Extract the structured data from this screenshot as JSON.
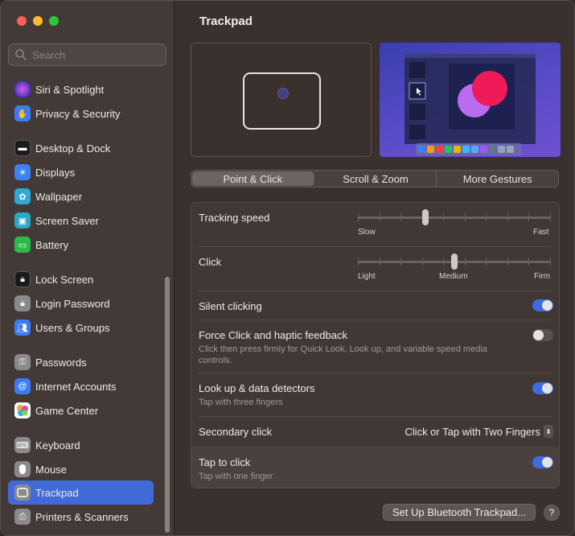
{
  "window": {
    "traffic_lights": [
      "close",
      "minimize",
      "zoom"
    ]
  },
  "sidebar": {
    "search_placeholder": "Search",
    "items": [
      {
        "label": "Siri & Spotlight",
        "icon": "siri-icon",
        "color": "#7b3fd6"
      },
      {
        "label": "Privacy & Security",
        "icon": "hand-icon",
        "color": "#3b7cf6"
      },
      {
        "label": "Desktop & Dock",
        "icon": "dock-icon",
        "color": "#1a1a1a"
      },
      {
        "label": "Displays",
        "icon": "sun-icon",
        "color": "#3b82f6"
      },
      {
        "label": "Wallpaper",
        "icon": "flower-icon",
        "color": "#31a8d8"
      },
      {
        "label": "Screen Saver",
        "icon": "screen-saver-icon",
        "color": "#2ba6c4"
      },
      {
        "label": "Battery",
        "icon": "battery-icon",
        "color": "#2fb94a"
      },
      {
        "label": "Lock Screen",
        "icon": "lock-icon",
        "color": "#1a1a1a"
      },
      {
        "label": "Login Password",
        "icon": "lock-icon",
        "color": "#8a8a8a"
      },
      {
        "label": "Users & Groups",
        "icon": "users-icon",
        "color": "#3b7cf6"
      },
      {
        "label": "Passwords",
        "icon": "key-icon",
        "color": "#8a8a8a"
      },
      {
        "label": "Internet Accounts",
        "icon": "at-icon",
        "color": "#3b7cf6"
      },
      {
        "label": "Game Center",
        "icon": "game-center-icon",
        "color": "#ffffff"
      },
      {
        "label": "Keyboard",
        "icon": "keyboard-icon",
        "color": "#8a8a8a"
      },
      {
        "label": "Mouse",
        "icon": "mouse-icon",
        "color": "#8a8a8a"
      },
      {
        "label": "Trackpad",
        "icon": "trackpad-icon",
        "color": "#8a8a8a"
      },
      {
        "label": "Printers & Scanners",
        "icon": "printer-icon",
        "color": "#8a8a8a"
      }
    ],
    "active_item": "Trackpad"
  },
  "main": {
    "title": "Trackpad",
    "tabs": [
      {
        "label": "Point & Click",
        "active": true
      },
      {
        "label": "Scroll & Zoom",
        "active": false
      },
      {
        "label": "More Gestures",
        "active": false
      }
    ],
    "tracking_speed": {
      "label": "Tracking speed",
      "min_label": "Slow",
      "max_label": "Fast",
      "value": 0.35
    },
    "click": {
      "label": "Click",
      "left_label": "Light",
      "mid_label": "Medium",
      "right_label": "Firm",
      "value": 0.5
    },
    "silent_clicking": {
      "label": "Silent clicking",
      "on": true
    },
    "force_click": {
      "label": "Force Click and haptic feedback",
      "description": "Click then press firmly for Quick Look, Look up, and variable speed media controls.",
      "on": false
    },
    "look_up": {
      "label": "Look up & data detectors",
      "description": "Tap with three fingers",
      "on": true
    },
    "secondary_click": {
      "label": "Secondary click",
      "value": "Click or Tap with Two Fingers"
    },
    "tap_to_click": {
      "label": "Tap to click",
      "description": "Tap with one finger",
      "on": true
    },
    "setup_button": "Set Up Bluetooth Trackpad...",
    "help_button": "?"
  },
  "colors": {
    "accent": "#3c6de0",
    "sidebar_selected": "#3f6ad8"
  }
}
